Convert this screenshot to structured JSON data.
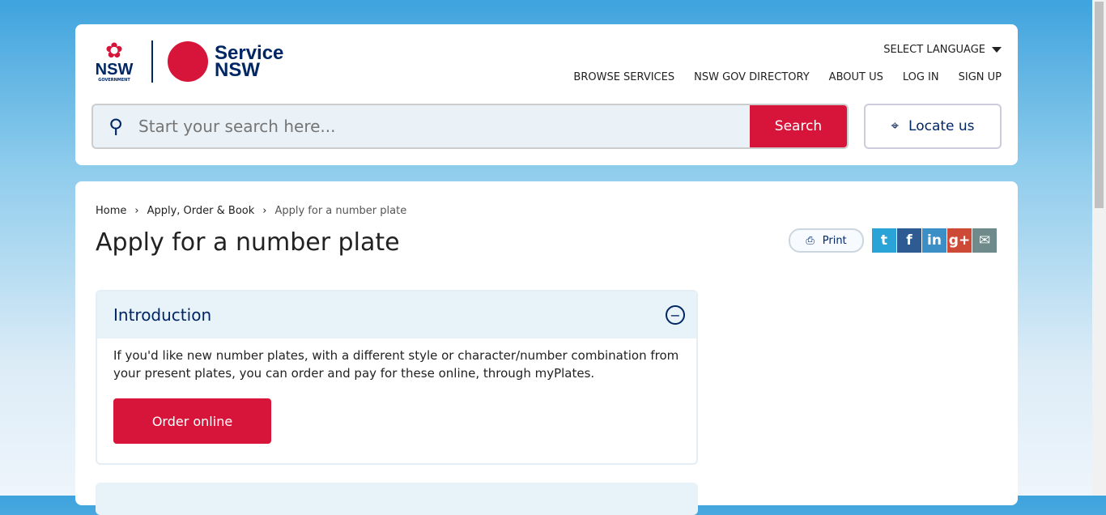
{
  "header": {
    "logo_nsw": "NSW",
    "logo_gov": "GOVERNMENT",
    "logo_service": "Service",
    "logo_service_nsw": "NSW",
    "language": "SELECT LANGUAGE",
    "nav": [
      "BROWSE SERVICES",
      "NSW GOV DIRECTORY",
      "ABOUT US",
      "LOG IN",
      "SIGN UP"
    ],
    "search_placeholder": "Start your search here...",
    "search_button": "Search",
    "locate": "Locate us"
  },
  "breadcrumb": [
    "Home",
    "Apply, Order & Book",
    "Apply for a number plate"
  ],
  "page_title": "Apply for a number plate",
  "print": "Print",
  "social": [
    "twitter",
    "facebook",
    "linkedin",
    "google-plus",
    "email"
  ],
  "intro": {
    "title": "Introduction",
    "text": "If you'd like new number plates, with a different style or character/number combination from your present plates, you can order and pay for these online, through myPlates.",
    "button": "Order online"
  }
}
